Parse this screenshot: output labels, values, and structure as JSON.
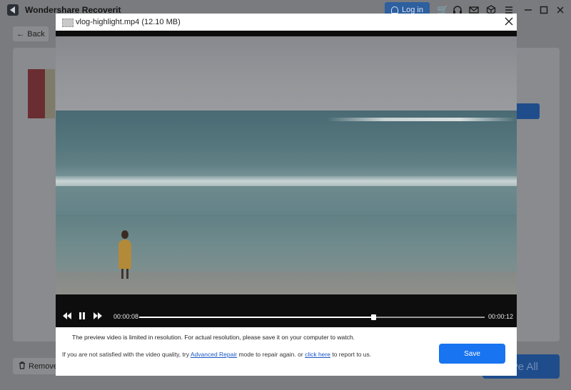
{
  "app": {
    "title": "Wondershare Recoverit",
    "login_label": "Log in",
    "back_label": "Back",
    "remove_label": "Remove",
    "save_all_label": "Save All"
  },
  "icons": {
    "cart": "cart-icon",
    "headset": "headset-icon",
    "mail": "mail-icon",
    "cube": "cube-icon",
    "menu": "menu-icon"
  },
  "preview": {
    "file_title": "vlog-highlight.mp4 (12.10 MB)",
    "current_time": "00:00:08",
    "total_time": "00:00:12",
    "progress": 0.677,
    "notice": "The preview video is limited in resolution. For actual resolution, please save it on your computer to watch.",
    "hint_prefix": "If you are not satisfied with the video quality, try ",
    "advanced_repair_link": "Advanced Repair",
    "hint_middle": " mode to repair again. or ",
    "click_here_link": "click here",
    "hint_suffix": " to report to us.",
    "save_label": "Save"
  },
  "colors": {
    "accent": "#1874f0",
    "link": "#1a56c4"
  }
}
